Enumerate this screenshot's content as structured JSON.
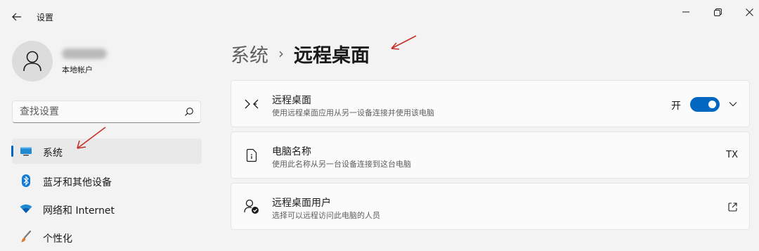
{
  "window": {
    "app_title": "设置",
    "back_icon": "back-arrow-icon",
    "controls": [
      "minimize-icon",
      "restore-icon",
      "close-icon"
    ]
  },
  "account": {
    "type": "本地帐户"
  },
  "search": {
    "placeholder": "查找设置"
  },
  "sidebar": {
    "items": [
      {
        "label": "系统",
        "icon": "monitor-icon",
        "active": true
      },
      {
        "label": "蓝牙和其他设备",
        "icon": "bluetooth-icon",
        "active": false
      },
      {
        "label": "网络和 Internet",
        "icon": "wifi-icon",
        "active": false
      },
      {
        "label": "个性化",
        "icon": "brush-icon",
        "active": false
      }
    ]
  },
  "breadcrumb": {
    "parent": "系统",
    "separator": "›",
    "current": "远程桌面"
  },
  "cards": [
    {
      "title": "远程桌面",
      "description": "使用远程桌面应用从另一设备连接并使用该电脑",
      "icon": "remote-desktop-icon",
      "toggle_label": "开",
      "toggle_on": true
    },
    {
      "title": "电脑名称",
      "description": "使用此名称从另一台设备连接到这台电脑",
      "icon": "pc-name-icon",
      "value": "TX"
    },
    {
      "title": "远程桌面用户",
      "description": "选择可以远程访问此电脑的人员",
      "icon": "remote-users-icon",
      "action_icon": "external-link-icon"
    }
  ],
  "colors": {
    "accent": "#0067c0",
    "annotation": "#c4312a",
    "background": "#f3f3f3",
    "card": "#fbfbfb"
  }
}
